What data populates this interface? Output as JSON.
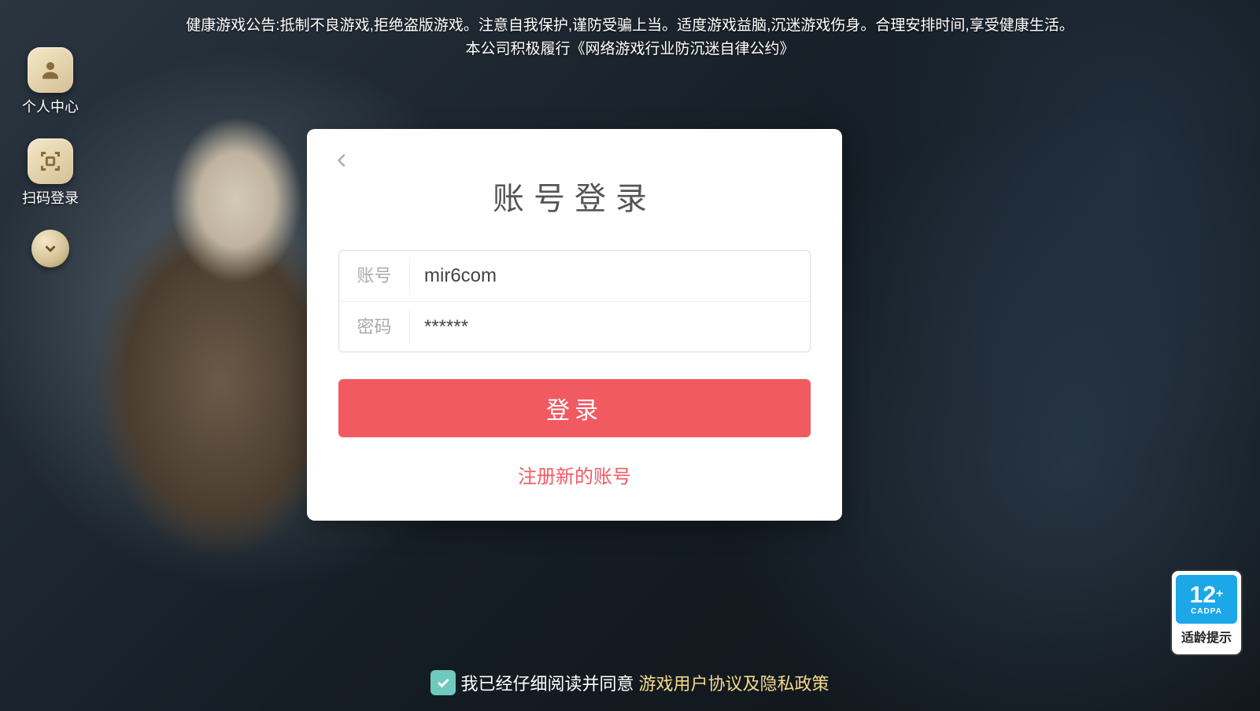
{
  "notice": {
    "line1": "健康游戏公告:抵制不良游戏,拒绝盗版游戏。注意自我保护,谨防受骗上当。适度游戏益脑,沉迷游戏伤身。合理安排时间,享受健康生活。",
    "line2": "本公司积极履行《网络游戏行业防沉迷自律公约》"
  },
  "side": {
    "personal_center": "个人中心",
    "qr_login": "扫码登录"
  },
  "login": {
    "title": "账号登录",
    "account_label": "账号",
    "account_value": "mir6com",
    "password_label": "密码",
    "password_value": "******",
    "button": "登录",
    "register": "注册新的账号"
  },
  "consent": {
    "prefix": "我已经仔细阅读并同意",
    "link": "游戏用户协议及隐私政策"
  },
  "age_badge": {
    "number": "12",
    "plus": "+",
    "cadpa": "CADPA",
    "label": "适龄提示"
  }
}
